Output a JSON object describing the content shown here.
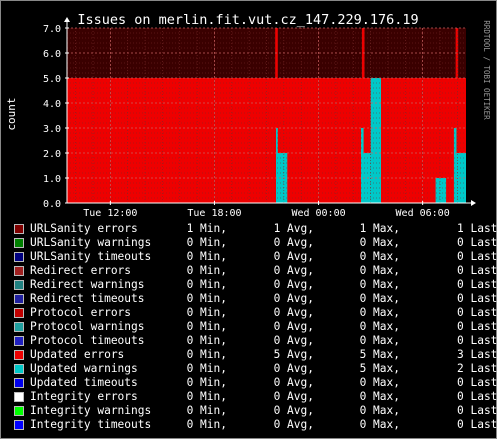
{
  "chart_data": {
    "type": "area",
    "title": "Issues on merlin.fit.vut.cz_147.229.176.19",
    "ylabel": "count",
    "watermark": "RRDTOOL / TOBI OETIKER",
    "ylim": [
      0,
      7
    ],
    "yticks": [
      "0.0",
      "1.0",
      "2.0",
      "3.0",
      "4.0",
      "5.0",
      "6.0",
      "7.0"
    ],
    "xlim": [
      9.5,
      32.5
    ],
    "xticks": [
      {
        "label": "Tue 12:00",
        "x": 12
      },
      {
        "label": "Tue 18:00",
        "x": 18
      },
      {
        "label": "Wed 00:00",
        "x": 24
      },
      {
        "label": "Wed 06:00",
        "x": 30
      }
    ],
    "grid": true,
    "series": [
      {
        "name": "Updated errors",
        "color": "#ee0000",
        "points": [
          [
            9.5,
            5
          ],
          [
            21.5,
            5
          ],
          [
            21.5,
            7
          ],
          [
            21.65,
            7
          ],
          [
            21.65,
            5
          ],
          [
            26.5,
            5
          ],
          [
            26.5,
            7
          ],
          [
            26.65,
            7
          ],
          [
            26.65,
            5
          ],
          [
            31.9,
            5
          ],
          [
            31.9,
            7
          ],
          [
            32.05,
            7
          ],
          [
            32.05,
            5
          ],
          [
            32.5,
            5
          ]
        ]
      },
      {
        "name": "Updated warnings",
        "color": "#00c8c8",
        "points": [
          [
            9.5,
            0
          ],
          [
            21.55,
            0
          ],
          [
            21.55,
            3
          ],
          [
            21.65,
            3
          ],
          [
            21.65,
            2
          ],
          [
            22.2,
            2
          ],
          [
            22.2,
            0
          ],
          [
            26.45,
            0
          ],
          [
            26.45,
            3
          ],
          [
            26.6,
            3
          ],
          [
            26.6,
            2
          ],
          [
            27.0,
            2
          ],
          [
            27.0,
            5
          ],
          [
            27.6,
            5
          ],
          [
            27.6,
            0
          ],
          [
            30.75,
            0
          ],
          [
            30.75,
            1
          ],
          [
            31.35,
            1
          ],
          [
            31.35,
            0
          ],
          [
            31.8,
            0
          ],
          [
            31.8,
            3
          ],
          [
            31.95,
            3
          ],
          [
            31.95,
            2
          ],
          [
            32.5,
            2
          ],
          [
            32.5,
            0
          ]
        ]
      }
    ]
  },
  "legend": [
    {
      "name": "URLSanity errors",
      "color": "#800000",
      "min": "1 Min,",
      "avg": "1 Avg,",
      "max": "1 Max,",
      "last": "1 Last"
    },
    {
      "name": "URLSanity warnings",
      "color": "#008000",
      "min": "0 Min,",
      "avg": "0 Avg,",
      "max": "0 Max,",
      "last": "0 Last"
    },
    {
      "name": "URLSanity timeouts",
      "color": "#000080",
      "min": "0 Min,",
      "avg": "0 Avg,",
      "max": "0 Max,",
      "last": "0 Last"
    },
    {
      "name": "Redirect errors",
      "color": "#a02020",
      "min": "0 Min,",
      "avg": "0 Avg,",
      "max": "0 Max,",
      "last": "0 Last"
    },
    {
      "name": "Redirect warnings",
      "color": "#208080",
      "min": "0 Min,",
      "avg": "0 Avg,",
      "max": "0 Max,",
      "last": "0 Last"
    },
    {
      "name": "Redirect timeouts",
      "color": "#2020a0",
      "min": "0 Min,",
      "avg": "0 Avg,",
      "max": "0 Max,",
      "last": "0 Last"
    },
    {
      "name": "Protocol errors",
      "color": "#c00000",
      "min": "0 Min,",
      "avg": "0 Avg,",
      "max": "0 Max,",
      "last": "0 Last"
    },
    {
      "name": "Protocol warnings",
      "color": "#20a0a0",
      "min": "0 Min,",
      "avg": "0 Avg,",
      "max": "0 Max,",
      "last": "0 Last"
    },
    {
      "name": "Protocol timeouts",
      "color": "#2020c0",
      "min": "0 Min,",
      "avg": "0 Avg,",
      "max": "0 Max,",
      "last": "0 Last"
    },
    {
      "name": "Updated errors",
      "color": "#ee0000",
      "min": "0 Min,",
      "avg": "5 Avg,",
      "max": "5 Max,",
      "last": "3 Last"
    },
    {
      "name": "Updated warnings",
      "color": "#00c8c8",
      "min": "0 Min,",
      "avg": "0 Avg,",
      "max": "5 Max,",
      "last": "2 Last"
    },
    {
      "name": "Updated timeouts",
      "color": "#0000ee",
      "min": "0 Min,",
      "avg": "0 Avg,",
      "max": "0 Max,",
      "last": "0 Last"
    },
    {
      "name": "Integrity errors",
      "color": "#ffffff",
      "min": "0 Min,",
      "avg": "0 Avg,",
      "max": "0 Max,",
      "last": "0 Last"
    },
    {
      "name": "Integrity warnings",
      "color": "#00ff00",
      "min": "0 Min,",
      "avg": "0 Avg,",
      "max": "0 Max,",
      "last": "0 Last"
    },
    {
      "name": "Integrity timeouts",
      "color": "#0000ff",
      "min": "0 Min,",
      "avg": "0 Avg,",
      "max": "0 Max,",
      "last": "0 Last"
    }
  ]
}
